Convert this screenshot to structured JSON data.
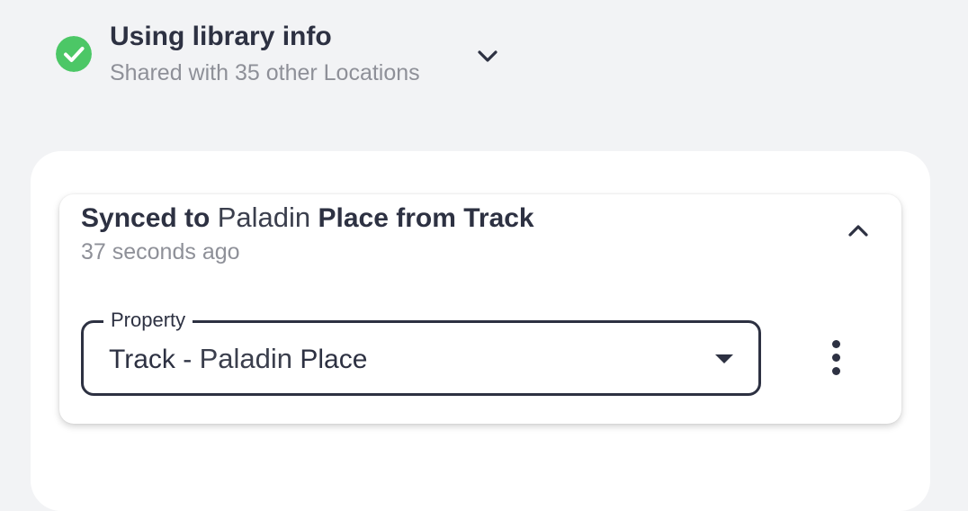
{
  "status": {
    "title": "Using library info",
    "subtitle": "Shared with 35 other Locations",
    "icon": "check-circle-icon",
    "icon_color": "#4cc766"
  },
  "sync_card": {
    "title_prefix": "Synced to",
    "title_place": "Paladin",
    "title_suffix": "Place from Track",
    "timestamp": "37 seconds ago",
    "collapse_icon": "chevron-up-icon"
  },
  "property_select": {
    "label": "Property",
    "value_prefix": "Track -",
    "value_place": "Paladin",
    "value_suffix": "Place",
    "caret_icon": "caret-down-icon"
  },
  "more_menu": {
    "icon": "more-vertical-icon"
  },
  "colors": {
    "background": "#f2f3f5",
    "text_primary": "#2d3142",
    "text_secondary": "#8e9098",
    "success": "#4cc766"
  }
}
